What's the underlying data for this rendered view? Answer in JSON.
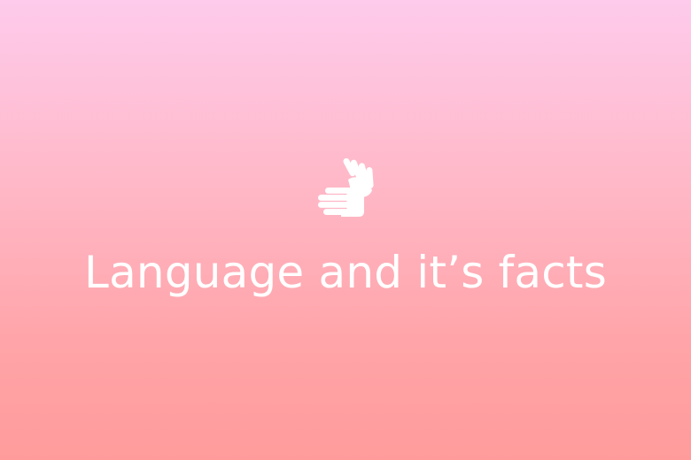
{
  "slide": {
    "icon": "sign-language-hands-icon",
    "title": "Language and it’s facts",
    "background_top": "#fecbec",
    "background_bottom": "#ff9b9b",
    "text_color": "#ffffff"
  }
}
